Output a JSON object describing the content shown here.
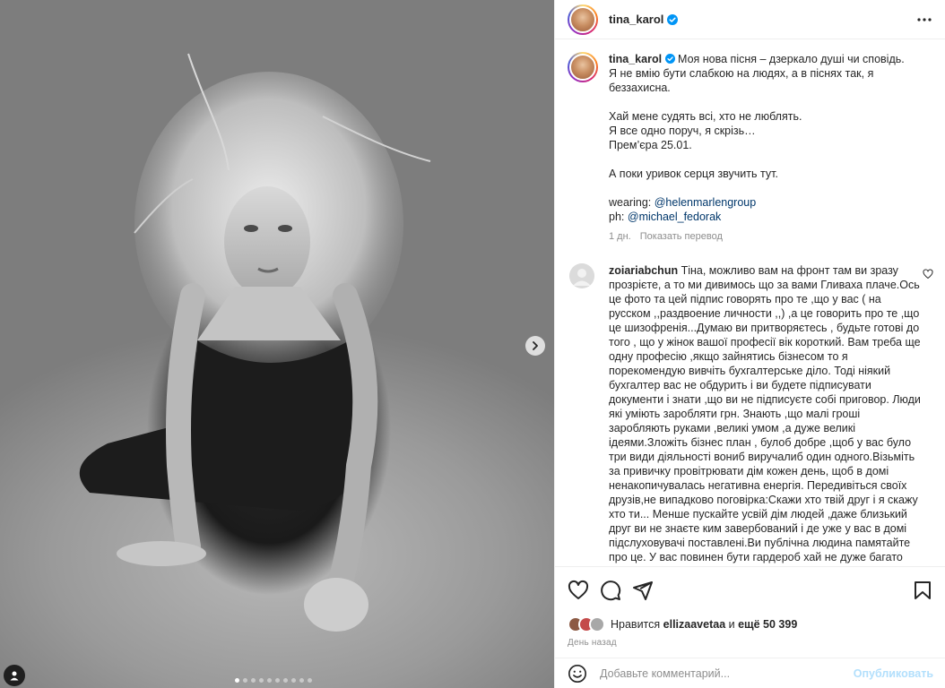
{
  "post": {
    "username": "tina_karol",
    "verified": true
  },
  "caption": {
    "username": "tina_karol",
    "lines": [
      "Моя нова пісня – дзеркало душі чи сповідь.",
      "Я не вмію бути слабкою на людях, а в піснях так, я беззахисна.",
      "",
      "Хай мене судять всі, хто не люблять.",
      "Я все одно поруч, я скрізь…",
      "Прем’єра 25.01.",
      "",
      "А поки уривок серця звучить тут.",
      ""
    ],
    "wearing_label": "wearing:",
    "wearing_mention": "@helenmarlengroup",
    "ph_label": "ph:",
    "ph_mention": "@michael_fedorak",
    "age": "1 дн.",
    "translate": "Показать перевод"
  },
  "comment": {
    "username": "zoiariabchun",
    "text": "Тіна, можливо вам на фронт там ви зразу прозрієте, а то ми дивимось що за вами Гливаха плаче.Ось це фото та цей підпис говорять про те ,що у вас ( на русском ,,раздвоение личности ,,) ,а це говорить про те ,що це шизофренія...Думаю ви притворяєтесь , будьте готові до того , що у жінок вашої професії вік короткий. Вам треба ще одну професію ,якщо зайнятись бізнесом то я порекомендую вивчіть бухгалтерське діло. Тоді ніякий бухгалтер вас не обдурить і ви будете підписувати документи і знати ,що ви не підписуєте собі приговор. Люди які уміють заробляти грн. Знають ,що малі гроші заробляють руками ,великі умом ,а дуже великі ідеями.Зложіть бізнес план , булоб добре ,щоб у вас було три види діяльності вониб виручалиб один одного.Візьміть за привичку провітрювати дім кожен день, щоб в домі ненакопичувалась негативна енергія. Передивіться своїх друзів,не випадково поговірка:Скажи хто твій друг і я скажу хто ти... Менше пускайте усвій дім людей ,даже близький друг ви не знаєте ким завербований і де уже у вас в домі підслуховувачі поставлені.Ви публічна людина памятайте про це. У вас повинен бути гардероб хай не дуже багато ,але це дорога одежа , жінка тоді себе відчуває більш"
  },
  "likes": {
    "prefix": "Нравится",
    "liker": "ellizaavetaa",
    "joiner": "и",
    "rest": "ещё 50 399"
  },
  "date": "День назад",
  "add_comment": {
    "placeholder": "Добавьте комментарий...",
    "post_label": "Опубликовать"
  },
  "carousel": {
    "slide_count": 10,
    "active_index": 0
  },
  "icons": {
    "like": "heart-icon",
    "comment": "comment-icon",
    "share": "share-icon",
    "save": "bookmark-icon",
    "more": "more-icon",
    "next": "chevron-right-icon",
    "tagged": "user-tag-icon",
    "emoji": "emoji-icon"
  },
  "colors": {
    "verified": "#0095f6",
    "mention": "#00376b",
    "secondary_text": "#8e8e8e",
    "post_button_disabled": "#b2dffc"
  }
}
